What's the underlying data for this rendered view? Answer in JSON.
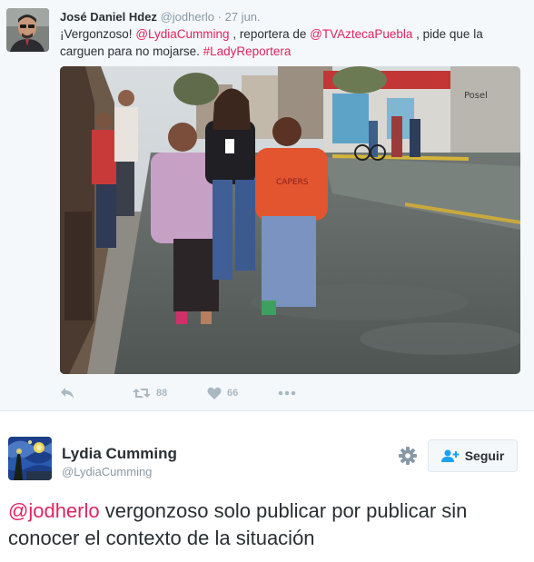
{
  "tweet1": {
    "author_name": "José Daniel Hdez",
    "author_handle": "@jodherlo",
    "separator": "·",
    "timestamp": "27 jun.",
    "text": {
      "part1": "¡Vergonzoso! ",
      "mention1": "@LydiaCumming",
      "part2": " , reportera de ",
      "mention2": "@TVAztecaPuebla",
      "part3": " , pide que la carguen para no mojarse. ",
      "hashtag": "#LadyReportera"
    },
    "actions": {
      "reply_icon": "reply-icon",
      "retweet_icon": "retweet-icon",
      "retweet_count": "88",
      "like_icon": "heart-icon",
      "like_count": "66",
      "more_icon": "more-icon"
    }
  },
  "tweet2": {
    "author_name": "Lydia Cumming",
    "author_handle": "@LydiaCumming",
    "settings_icon": "gear-icon",
    "follow_icon": "follow-user-icon",
    "follow_label": "Seguir",
    "text": {
      "mention": "@jodherlo",
      "body": " vergonzoso solo publicar por publicar sin conocer el contexto de la situación"
    }
  },
  "colors": {
    "link": "#e0245e",
    "muted": "#8899a6",
    "text": "#292f33",
    "action_icon": "#aab8c2"
  }
}
